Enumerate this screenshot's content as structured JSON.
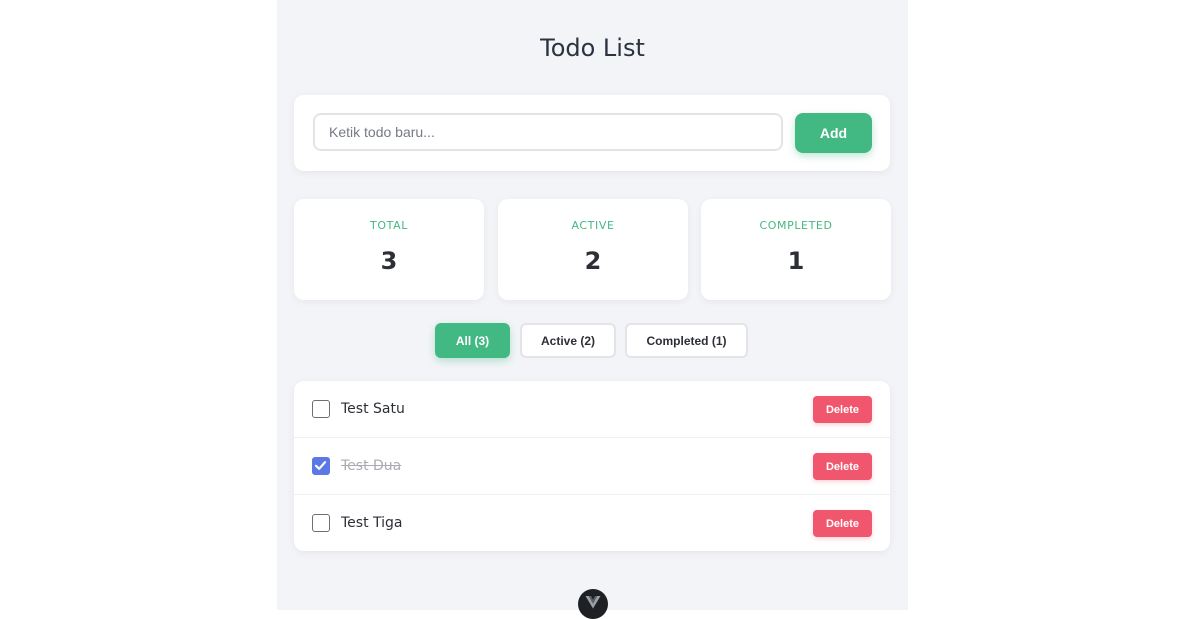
{
  "header": {
    "title": "Todo List"
  },
  "add_form": {
    "placeholder": "Ketik todo baru...",
    "value": "",
    "button_label": "Add"
  },
  "stats": [
    {
      "label": "TOTAL",
      "value": "3"
    },
    {
      "label": "ACTIVE",
      "value": "2"
    },
    {
      "label": "COMPLETED",
      "value": "1"
    }
  ],
  "filters": [
    {
      "label": "All (3)",
      "selected": true
    },
    {
      "label": "Active (2)",
      "selected": false
    },
    {
      "label": "Completed (1)",
      "selected": false
    }
  ],
  "todos": [
    {
      "text": "Test Satu",
      "completed": false,
      "delete_label": "Delete"
    },
    {
      "text": "Test Dua",
      "completed": true,
      "delete_label": "Delete"
    },
    {
      "text": "Test Tiga",
      "completed": false,
      "delete_label": "Delete"
    }
  ],
  "colors": {
    "accent": "#42b883",
    "danger": "#f0566e",
    "checkbox_checked": "#5b78e6",
    "background": "#f3f4f7"
  },
  "icons": {
    "checkmark": "check-icon",
    "devtools": "vue-devtools-icon"
  }
}
